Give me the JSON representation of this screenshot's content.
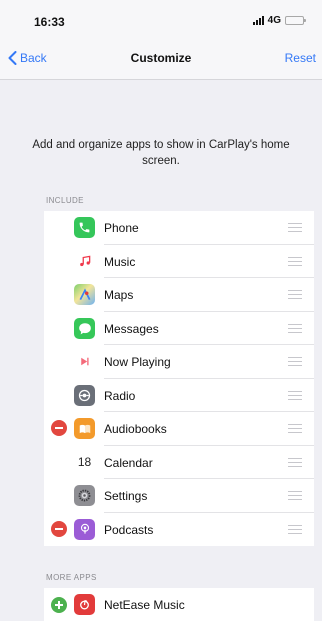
{
  "status": {
    "time": "16:33",
    "network": "4G"
  },
  "nav": {
    "back_label": "Back",
    "title": "Customize",
    "reset_label": "Reset"
  },
  "description": "Add and organize apps to show in CarPlay's home screen.",
  "include": {
    "header": "INCLUDE",
    "items": [
      {
        "label": "Phone",
        "icon": "phone-icon",
        "removable": false
      },
      {
        "label": "Music",
        "icon": "music-icon",
        "removable": false
      },
      {
        "label": "Maps",
        "icon": "maps-icon",
        "removable": false
      },
      {
        "label": "Messages",
        "icon": "messages-icon",
        "removable": false
      },
      {
        "label": "Now Playing",
        "icon": "now-playing-icon",
        "removable": false
      },
      {
        "label": "Radio",
        "icon": "radio-icon",
        "removable": false
      },
      {
        "label": "Audiobooks",
        "icon": "audiobooks-icon",
        "removable": true
      },
      {
        "label": "Calendar",
        "icon": "calendar-icon",
        "removable": false,
        "icon_text": "18"
      },
      {
        "label": "Settings",
        "icon": "settings-icon",
        "removable": false
      },
      {
        "label": "Podcasts",
        "icon": "podcasts-icon",
        "removable": true
      }
    ]
  },
  "more_apps": {
    "header": "MORE APPS",
    "items": [
      {
        "label": "NetEase Music",
        "icon": "netease-music-icon"
      }
    ]
  },
  "colors": {
    "accent": "#3478f6",
    "remove": "#e2473f",
    "add": "#4cb14e",
    "background": "#efeff4"
  }
}
